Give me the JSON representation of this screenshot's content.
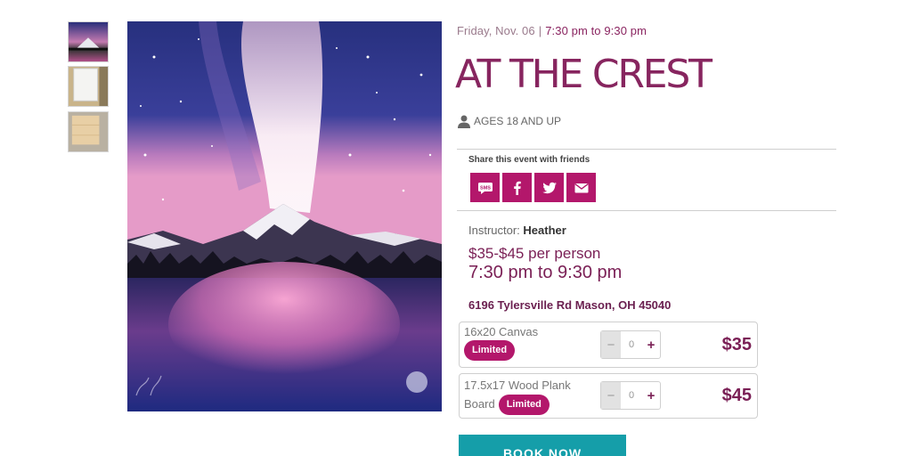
{
  "gallery": {
    "thumbnails": [
      "galaxy-painting-thumb",
      "blank-canvas-thumb",
      "wood-plank-thumb"
    ],
    "main_image": "galaxy-mountain-lake-painting"
  },
  "event": {
    "date": "Friday, Nov. 06",
    "separator": "|",
    "time_range": "7:30 pm to 9:30 pm",
    "title": "AT THE CREST",
    "ages": "AGES 18 AND UP"
  },
  "share": {
    "label": "Share this event with friends",
    "sms_text": "SMS"
  },
  "details": {
    "instructor_label": "Instructor:",
    "instructor_name": "Heather",
    "price": "$35-$45 per person",
    "time": "7:30 pm to 9:30 pm",
    "address": "6196 Tylersville Rd Mason, OH 45040"
  },
  "options": [
    {
      "name": "16x20 Canvas",
      "badge": "Limited",
      "quantity": "0",
      "minus": "−",
      "plus": "+",
      "price": "$35"
    },
    {
      "name": "17.5x17 Wood Plank Board",
      "name_line1": "17.5x17 Wood Plank",
      "name_line2": "Board",
      "badge": "Limited",
      "quantity": "0",
      "minus": "−",
      "plus": "+",
      "price": "$45"
    }
  ],
  "cta": {
    "book_label": "BOOK NOW"
  },
  "colors": {
    "brand": "#b3176b",
    "title": "#87255f",
    "cta": "#159ea9"
  }
}
